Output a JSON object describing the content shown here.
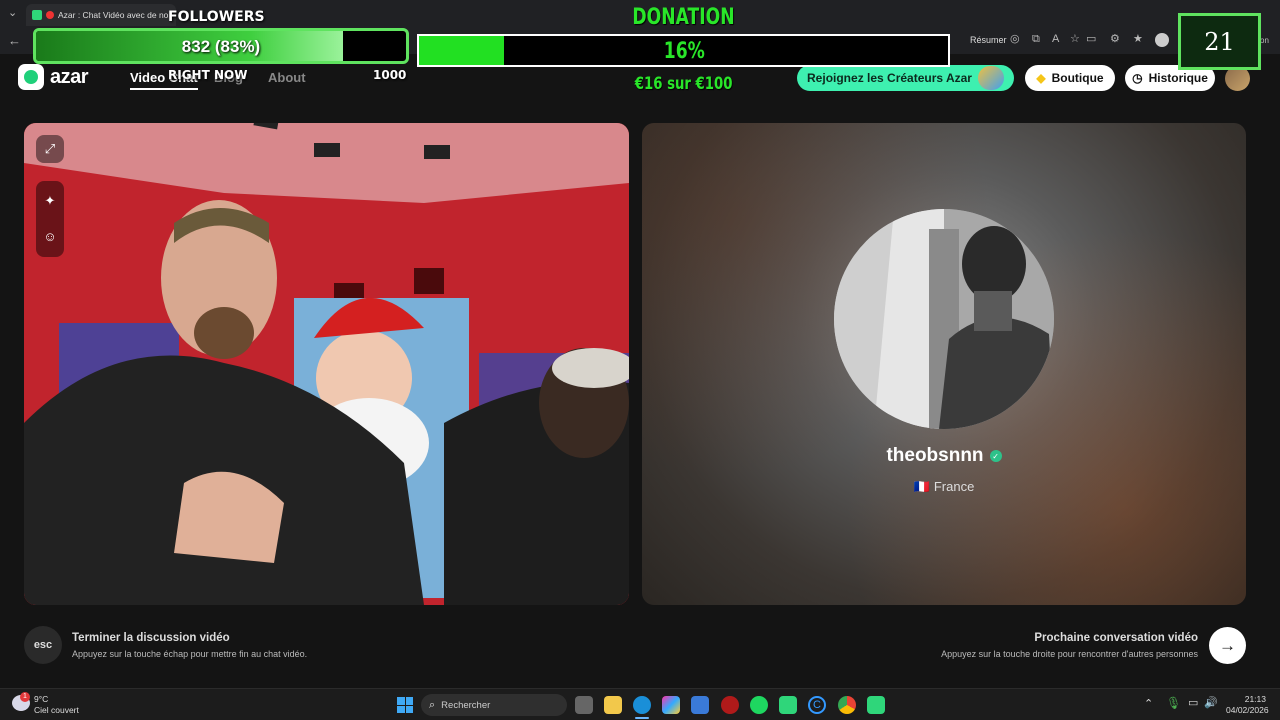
{
  "browser": {
    "tab_title": "Azar : Chat Vidéo avec de no",
    "summarize_label": "Résumer",
    "conversation_label": "nversation"
  },
  "overlay": {
    "followers_title": "FOLLOWERS",
    "followers_value": "832 (83%)",
    "followers_progress": 0.83,
    "right_now_label": "RIGHT NOW",
    "right_now_value": "1000",
    "donation_title": "DONATION",
    "donation_percent": "16%",
    "donation_progress": 0.16,
    "donation_amount": "€16 sur €100",
    "counter": "21"
  },
  "nav": {
    "logo": "azar",
    "links": [
      "Video Chat",
      "Blog",
      "About"
    ],
    "creators_button": "Rejoignez les Créateurs Azar",
    "shop_button": "Boutique",
    "history_button": "Historique"
  },
  "partner": {
    "username": "theobsnnn",
    "flag": "🇫🇷",
    "country": "France"
  },
  "controls": {
    "esc_key": "esc",
    "end_title": "Terminer la discussion vidéo",
    "end_sub": "Appuyez sur la touche échap pour mettre fin au chat vidéo.",
    "next_title": "Prochaine conversation vidéo",
    "next_sub": "Appuyez sur la touche droite pour rencontrer d'autres personnes",
    "next_icon": "arrow-right-icon"
  },
  "taskbar": {
    "weather_temp": "9°C",
    "weather_desc": "Ciel couvert",
    "weather_badge": "1",
    "search_placeholder": "Rechercher",
    "time": "21:13",
    "date": "04/02/2026"
  },
  "colors": {
    "accent_green": "#29e629",
    "creators_pill": "#3ef0b0"
  }
}
